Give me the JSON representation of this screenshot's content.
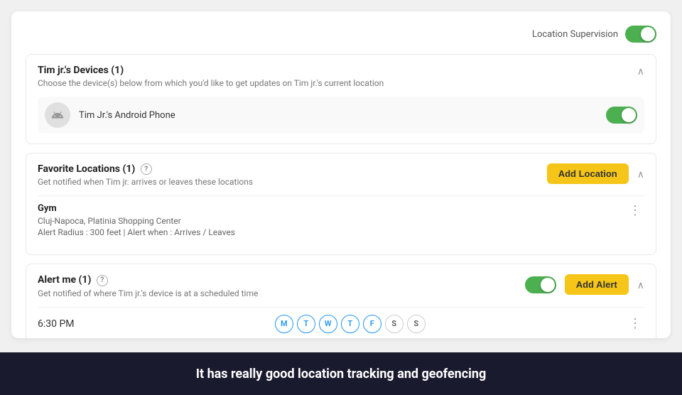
{
  "topBar": {
    "label": "Location Supervision",
    "toggleState": "on"
  },
  "devicesSection": {
    "title": "Tim jr.'s Devices (1)",
    "subtitle": "Choose the device(s) below from which you'd like to get updates on Tim jr.'s current location",
    "chevron": "∧",
    "device": {
      "name": "Tim Jr.'s Android Phone",
      "toggleState": "on"
    }
  },
  "favoriteLocationsSection": {
    "title": "Favorite Locations (1)",
    "subtitle": "Get notified when Tim jr. arrives or leaves these locations",
    "addButtonLabel": "Add Location",
    "chevron": "∧",
    "questionMark": "?",
    "locations": [
      {
        "name": "Gym",
        "address": "Cluj-Napoca, Platinia Shopping Center",
        "alert": "Alert Radius : 300 feet | Alert when : Arrives / Leaves"
      }
    ]
  },
  "alertMeSection": {
    "title": "Alert me (1)",
    "subtitle": "Get notified of where Tim jr.'s device is at a scheduled time",
    "addButtonLabel": "Add Alert",
    "toggleState": "on",
    "chevron": "∧",
    "questionMark": "?",
    "alerts": [
      {
        "time": "6:30 PM",
        "days": [
          {
            "label": "M",
            "active": true
          },
          {
            "label": "T",
            "active": true
          },
          {
            "label": "W",
            "active": true
          },
          {
            "label": "T",
            "active": true
          },
          {
            "label": "F",
            "active": true
          },
          {
            "label": "S",
            "active": false
          },
          {
            "label": "S",
            "active": false
          }
        ]
      }
    ]
  },
  "banner": {
    "text": "It has really good location tracking and geofencing"
  }
}
